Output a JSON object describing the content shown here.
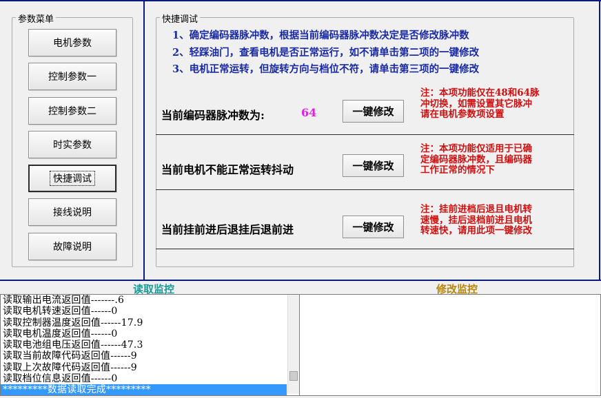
{
  "left_panel": {
    "title": "参数菜单",
    "buttons": [
      {
        "label": "电机参数"
      },
      {
        "label": "控制参数一"
      },
      {
        "label": "控制参数二"
      },
      {
        "label": "时实参数"
      },
      {
        "label": "快捷调试"
      },
      {
        "label": "接线说明"
      },
      {
        "label": "故障说明"
      }
    ],
    "active_index": 4
  },
  "quick_debug": {
    "title": "快捷调试",
    "steps": [
      "1、确定编码器脉冲数，根据当前编码器脉冲数决定是否修改脉冲数",
      "2、轻踩油门，查看电机是否正常运行，如不请单击第二项的一键修改",
      "3、电机正常运转，但旋转方向与档位不符，请单击第三项的一键修改"
    ],
    "rows": [
      {
        "label": "当前编码器脉冲数为:",
        "value": "64",
        "button": "一键修改",
        "note": [
          "注：本项功能仅在48和64脉",
          "冲切换，如需设置其它脉冲",
          "请在电机参数项设置"
        ]
      },
      {
        "label": "当前电机不能正常运转抖动",
        "button": "一键修改",
        "note": [
          "注：本项功能仅适用于已确",
          "定编码器脉冲数，且编码器",
          "工作正常的情况下"
        ]
      },
      {
        "label": "当前挂前进后退挂后退前进",
        "button": "一键修改",
        "note": [
          "注：挂前进档后退且电机转",
          "速慢，挂后退档前进且电机",
          "转速快，请用此项一键修改"
        ]
      }
    ]
  },
  "read_monitor": {
    "title": "读取监控",
    "title_color": "#1a9a9a",
    "lines": [
      "读取输出电流返回值-------.6",
      "读取电机转速返回值------0",
      "读取控制器温度返回值------17.9",
      "读取电机温度返回值------0",
      "读取电池组电压返回值------47.3",
      "读取当前故障代码返回值------9",
      "读取上次故障代码返回值------9",
      "读取档位信息返回值------0",
      "*********数据读取完成*********"
    ],
    "selected_index": 8
  },
  "modify_monitor": {
    "title": "修改监控",
    "title_color": "#b8860b"
  },
  "colors": {
    "accent_blue": "#1a2aa0",
    "pulse_value": "#e020e0",
    "note_red": "#d01010",
    "selection": "#3399ff"
  }
}
